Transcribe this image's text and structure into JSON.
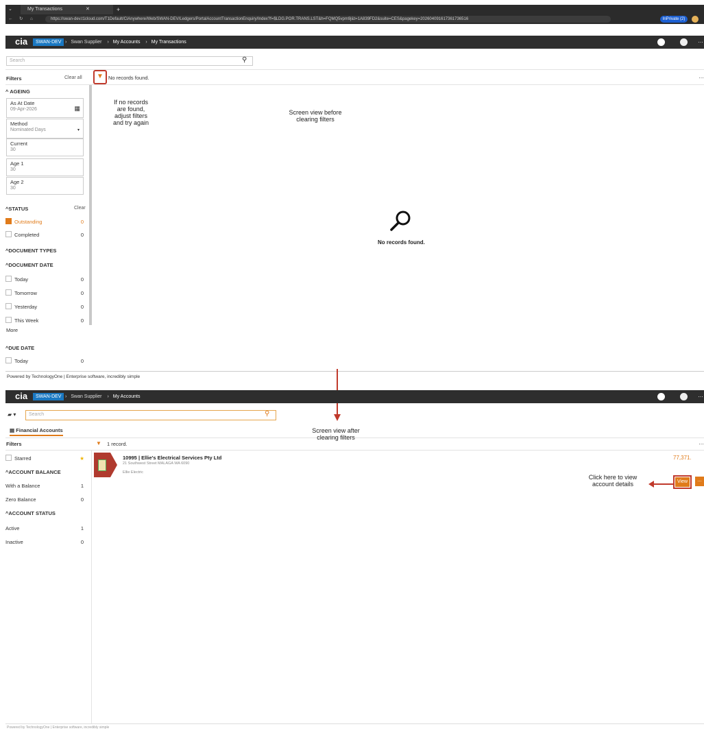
{
  "browser": {
    "tab_title": "My Transactions",
    "url": "https://swan-dev.t1cloud.com/T1Default/CiAnywhere/Web/SWAN-DEV/Ledgers/PortalAccountTransactionEnquiry/Index?f=$LDG.POR.TRANS.LST&h=FQMQ5vpm9j&t=1A839FD2&suite=CES&pagekey=20260409161736173651​6",
    "inprivate_label": "InPrivate (2)"
  },
  "top": {
    "app": "cia",
    "env": "SWAN-DEV",
    "crumbs": [
      "Swan Supplier",
      "My Accounts",
      "My Transactions"
    ],
    "search_placeholder": "Search",
    "filters_label": "Filters",
    "clear_all": "Clear all",
    "no_records_header": "No records found.",
    "ageing": {
      "title": "AGEING",
      "as_at_label": "As At Date",
      "as_at_value": "09-Apr-2026",
      "method_label": "Method",
      "method_value": "Nominated Days",
      "current_label": "Current",
      "current_value": "30",
      "age1_label": "Age 1",
      "age1_value": "30",
      "age2_label": "Age 2",
      "age2_value": "30"
    },
    "status": {
      "title": "STATUS",
      "clear": "Clear",
      "items": [
        {
          "label": "Outstanding",
          "count": "0"
        },
        {
          "label": "Completed",
          "count": "0"
        }
      ]
    },
    "document_types": "DOCUMENT TYPES",
    "document_date": {
      "title": "DOCUMENT DATE",
      "items": [
        {
          "label": "Today",
          "count": "0"
        },
        {
          "label": "Tomorrow",
          "count": "0"
        },
        {
          "label": "Yesterday",
          "count": "0"
        },
        {
          "label": "This Week",
          "count": "0"
        }
      ],
      "more": "More"
    },
    "due_date": {
      "title": "DUE DATE",
      "items": [
        {
          "label": "Today",
          "count": "0"
        }
      ]
    },
    "empty_message": "No records found.",
    "footer": "Powered by TechnologyOne  |  Enterprise software, incredibly simple"
  },
  "bottom": {
    "crumbs": [
      "Swan Supplier",
      "My Accounts"
    ],
    "search_placeholder": "Search",
    "tab_label": "Financial Accounts",
    "filters_label": "Filters",
    "record_count": "1 record.",
    "starred": "Starred",
    "account_balance": {
      "title": "ACCOUNT BALANCE",
      "items": [
        {
          "label": "With a Balance",
          "count": "1"
        },
        {
          "label": "Zero Balance",
          "count": "0"
        }
      ]
    },
    "account_status": {
      "title": "ACCOUNT STATUS",
      "items": [
        {
          "label": "Active",
          "count": "1"
        },
        {
          "label": "Inactive",
          "count": "0"
        }
      ]
    },
    "account": {
      "title": "10995 | Ellie's Electrical Services Pty Ltd",
      "address": "21 Southwest Street MALAGA WA 6090",
      "trading_name": "Ellie Electric",
      "balance": "77,371.",
      "view_label": "View"
    },
    "footer": "Powered by TechnologyOne  |  Enterprise software, incredibly simple"
  },
  "annotations": {
    "no_records_hint": [
      "If no records",
      "are found,",
      "adjust filters",
      "and try again"
    ],
    "before": [
      "Screen view before",
      "clearing filters"
    ],
    "after": [
      "Screen view after",
      "clearing filters"
    ],
    "view_hint": [
      "Click here to view",
      "account details"
    ]
  },
  "colors": {
    "accent_orange": "#e07b1a",
    "annotation_red": "#c0392b",
    "env_blue": "#1a78c2",
    "dark_bar": "#2e2e2e"
  }
}
